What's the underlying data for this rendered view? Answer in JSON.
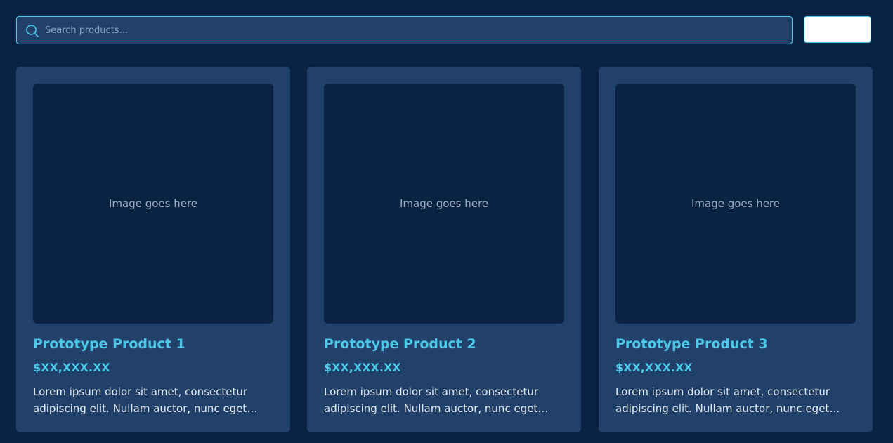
{
  "search": {
    "placeholder": "Search products...",
    "icon": "search-icon"
  },
  "action_button": {
    "label": ""
  },
  "products": [
    {
      "image_placeholder": "Image goes here",
      "title": "Prototype Product 1",
      "price": "$XX,XXX.XX",
      "description": "Lorem ipsum dolor sit amet, consectetur adipiscing elit. Nullam auctor, nunc eget ultricies tincidunt, nisl nisl aliquam nisl."
    },
    {
      "image_placeholder": "Image goes here",
      "title": "Prototype Product 2",
      "price": "$XX,XXX.XX",
      "description": "Lorem ipsum dolor sit amet, consectetur adipiscing elit. Nullam auctor, nunc eget ultricies tincidunt, nisl nisl aliquam nisl."
    },
    {
      "image_placeholder": "Image goes here",
      "title": "Prototype Product 3",
      "price": "$XX,XXX.XX",
      "description": "Lorem ipsum dolor sit amet, consectetur adipiscing elit. Nullam auctor, nunc eget ultricies tincidunt, nisl nisl aliquam nisl."
    }
  ],
  "colors": {
    "background": "#0b2343",
    "card": "#21416a",
    "accent": "#4cc9e8",
    "text": "#e3eaf2"
  }
}
